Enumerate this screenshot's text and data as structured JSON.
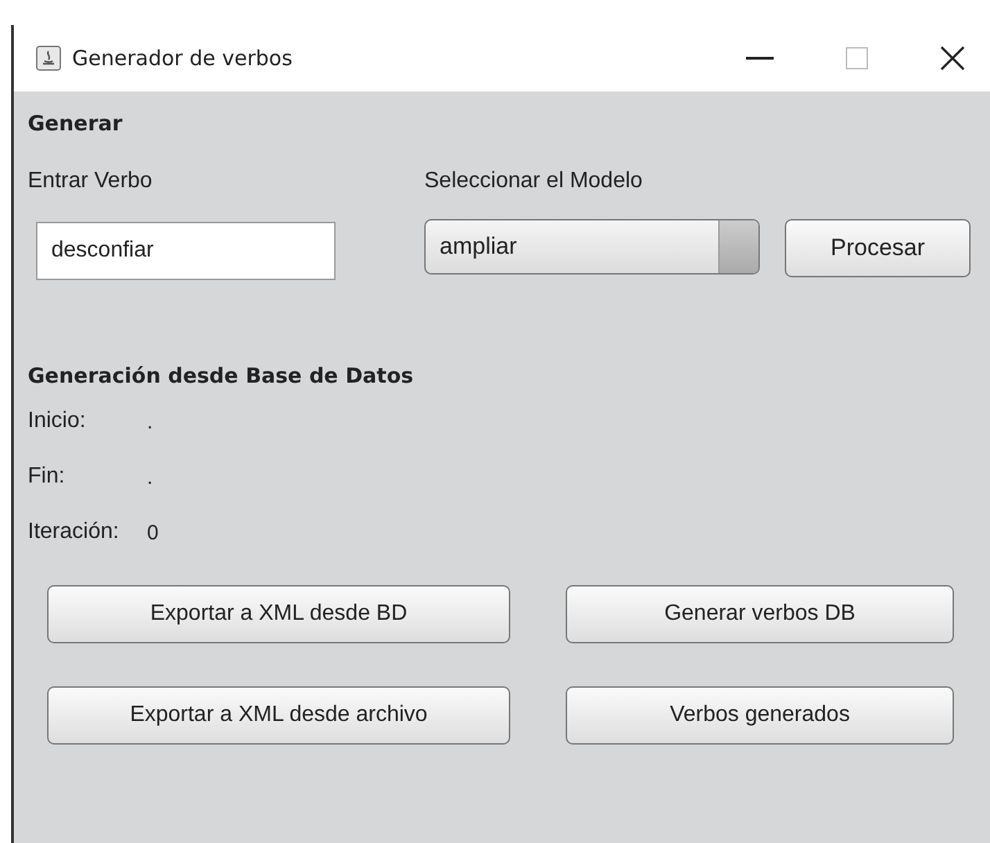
{
  "window": {
    "title": "Generador de verbos"
  },
  "generar": {
    "heading": "Generar",
    "verb_label": "Entrar Verbo",
    "verb_value": "desconfiar",
    "model_label": "Seleccionar el Modelo",
    "model_value": "ampliar",
    "process_button": "Procesar"
  },
  "database": {
    "heading": "Generación desde Base de Datos",
    "fields": [
      {
        "label": "Inicio:",
        "value": "."
      },
      {
        "label": "Fin:",
        "value": "."
      },
      {
        "label": "Iteración:",
        "value": "0"
      }
    ]
  },
  "buttons": [
    "Exportar a XML desde BD",
    "Generar verbos DB",
    "Exportar a XML desde archivo",
    "Verbos generados"
  ]
}
